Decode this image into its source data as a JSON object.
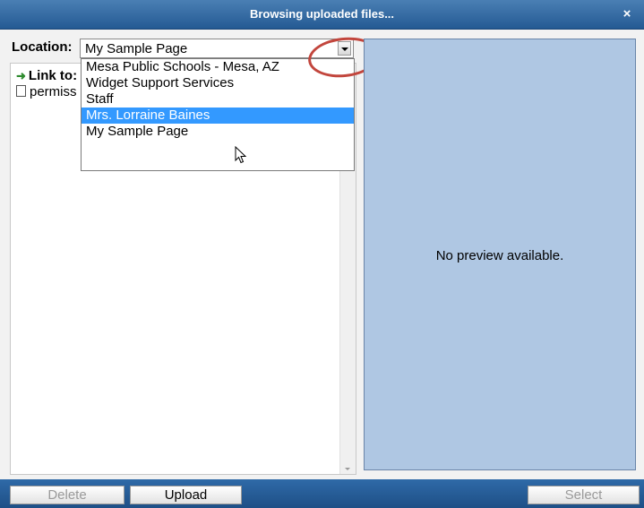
{
  "window": {
    "title": "Browsing uploaded files...",
    "close_label": "×"
  },
  "location": {
    "label": "Location:",
    "selected": "My Sample Page",
    "options": [
      "Mesa Public Schools - Mesa, AZ",
      "Widget Support Services",
      "Staff",
      "Mrs. Lorraine Baines",
      "My Sample Page"
    ],
    "highlighted_index": 3
  },
  "tree": {
    "link_label": "Link to:",
    "file_name": "permiss",
    "link_icon": "right-arrow-icon",
    "file_icon": "document-icon"
  },
  "preview": {
    "message": "No preview available."
  },
  "footer": {
    "delete_label": "Delete",
    "upload_label": "Upload",
    "select_label": "Select"
  },
  "colors": {
    "titlebar": "#245a93",
    "preview_bg": "#afc7e3",
    "selection": "#3399ff",
    "annotation": "#c2463d"
  }
}
